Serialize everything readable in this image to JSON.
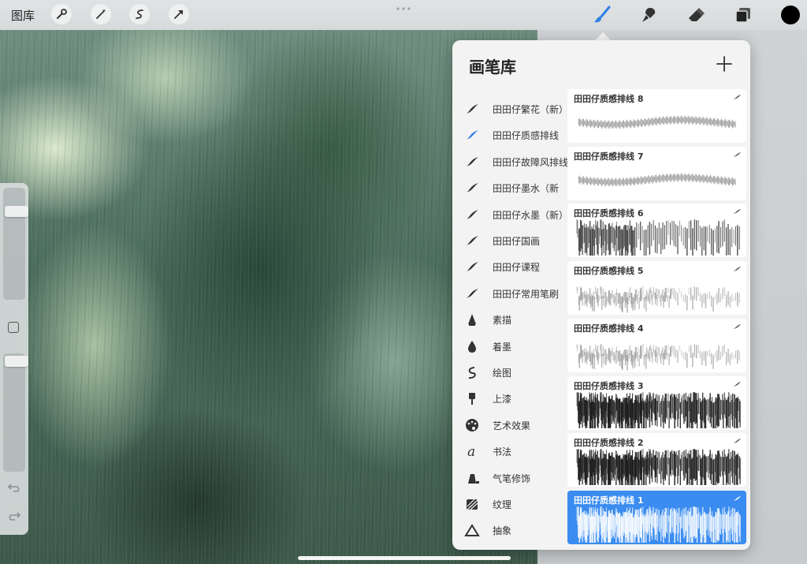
{
  "toolbar": {
    "gallery_label": "图库",
    "left_tools": [
      {
        "icon": "wrench-icon"
      },
      {
        "icon": "magic-wand-icon"
      },
      {
        "icon": "selection-icon"
      },
      {
        "icon": "transform-arrow-icon"
      }
    ],
    "right_tools": [
      {
        "icon": "brush-icon",
        "active": true,
        "color": "#2f7fe6"
      },
      {
        "icon": "smudge-icon"
      },
      {
        "icon": "eraser-icon"
      },
      {
        "icon": "layers-icon"
      }
    ],
    "current_color": "#000000"
  },
  "sidebar": {
    "brush_size": 0.82,
    "opacity": 0.98,
    "undo_icon": "undo-arrow-icon",
    "redo_icon": "redo-arrow-icon"
  },
  "brush_library": {
    "title": "画笔库",
    "add_icon": "plus-icon",
    "sets": [
      {
        "label": "田田仔繁花（新）",
        "icon": "brush-stroke-icon"
      },
      {
        "label": "田田仔质感排线",
        "icon": "brush-stroke-icon",
        "selected": true
      },
      {
        "label": "田田仔故障风排线",
        "icon": "brush-stroke-icon"
      },
      {
        "label": "田田仔墨水（新",
        "icon": "brush-stroke-icon"
      },
      {
        "label": "田田仔水墨（新）",
        "icon": "brush-stroke-icon"
      },
      {
        "label": "田田仔国画",
        "icon": "brush-stroke-icon"
      },
      {
        "label": "田田仔课程",
        "icon": "brush-stroke-icon"
      },
      {
        "label": "田田仔常用笔刷",
        "icon": "brush-stroke-icon"
      },
      {
        "label": "素描",
        "icon": "pencil-tip-icon"
      },
      {
        "label": "着墨",
        "icon": "ink-drop-icon"
      },
      {
        "label": "绘图",
        "icon": "squiggle-icon"
      },
      {
        "label": "上漆",
        "icon": "paint-brush-icon"
      },
      {
        "label": "艺术效果",
        "icon": "palette-icon"
      },
      {
        "label": "书法",
        "icon": "calligraphy-icon"
      },
      {
        "label": "气笔修饰",
        "icon": "airbrush-icon"
      },
      {
        "label": "纹理",
        "icon": "texture-icon"
      },
      {
        "label": "抽象",
        "icon": "triangle-icon"
      }
    ],
    "brushes": [
      {
        "name": "田田仔质感排线 8",
        "style": "smooth"
      },
      {
        "name": "田田仔质感排线 7",
        "style": "smooth"
      },
      {
        "name": "田田仔质感排线 6",
        "style": "vertical"
      },
      {
        "name": "田田仔质感排线 5",
        "style": "light"
      },
      {
        "name": "田田仔质感排线 4",
        "style": "light"
      },
      {
        "name": "田田仔质感排线 3",
        "style": "dense"
      },
      {
        "name": "田田仔质感排线 2",
        "style": "dense"
      },
      {
        "name": "田田仔质感排线 1",
        "style": "selected",
        "selected": true
      }
    ]
  }
}
